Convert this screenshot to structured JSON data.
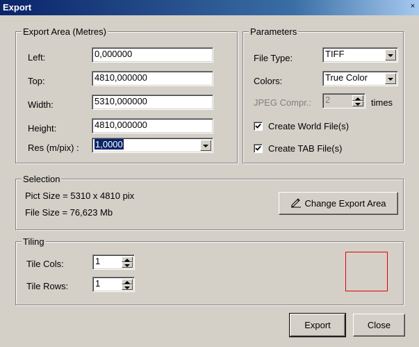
{
  "window": {
    "title": "Export",
    "close_glyph": "×"
  },
  "export_area": {
    "title": "Export Area (Metres)",
    "left_label": "Left:",
    "left_value": "0,000000",
    "top_label": "Top:",
    "top_value": "4810,000000",
    "width_label": "Width:",
    "width_value": "5310,000000",
    "height_label": "Height:",
    "height_value": "4810,000000",
    "res_label": "Res (m/pix) :",
    "res_value": "1,0000"
  },
  "parameters": {
    "title": "Parameters",
    "file_type_label": "File Type:",
    "file_type_value": "TIFF",
    "colors_label": "Colors:",
    "colors_value": "True Color",
    "jpeg_label": "JPEG Compr.:",
    "jpeg_value": "2",
    "jpeg_unit": "times",
    "world_file_label": "Create World File(s)",
    "world_file_checked": true,
    "tab_file_label": "Create TAB File(s)",
    "tab_file_checked": true
  },
  "selection": {
    "title": "Selection",
    "pict_size": "Pict Size = 5310 x 4810 pix",
    "file_size": "File Size = 76,623 Mb",
    "change_button": "Change Export Area",
    "change_icon": "pencil-icon"
  },
  "tiling": {
    "title": "Tiling",
    "cols_label": "Tile Cols:",
    "cols_value": "1",
    "rows_label": "Tile Rows:",
    "rows_value": "1",
    "preview_color": "#e00000"
  },
  "footer": {
    "export_button": "Export",
    "close_button": "Close"
  },
  "colors": {
    "title_bar": "#0a246a",
    "face": "#d4d0c8",
    "selection_highlight": "#0a246a"
  }
}
